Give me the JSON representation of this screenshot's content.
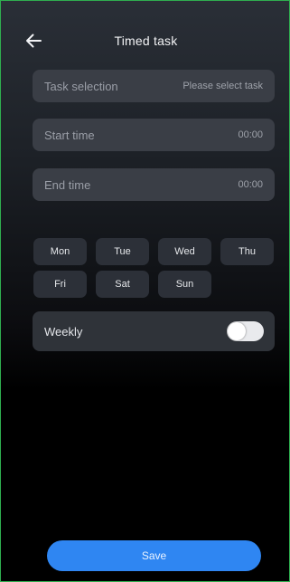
{
  "header": {
    "back_icon": "arrow-left-icon",
    "title": "Timed task"
  },
  "form": {
    "task_selection": {
      "label": "Task selection",
      "value": "Please select task"
    },
    "start_time": {
      "label": "Start time",
      "value": "00:00"
    },
    "end_time": {
      "label": "End time",
      "value": "00:00"
    }
  },
  "days": [
    "Mon",
    "Tue",
    "Wed",
    "Thu",
    "Fri",
    "Sat",
    "Sun"
  ],
  "weekly": {
    "label": "Weekly",
    "toggle_on": false
  },
  "footer": {
    "save_label": "Save"
  },
  "colors": {
    "accent": "#2f86f2",
    "border": "#2fae4f"
  }
}
